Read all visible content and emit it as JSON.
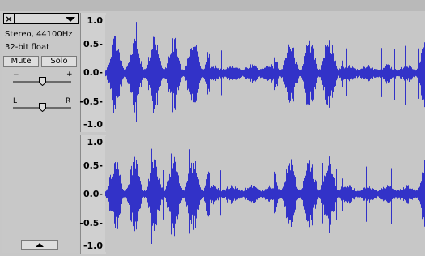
{
  "track": {
    "close_glyph": "×",
    "name": "",
    "dropdown_icon": "chevron-down-icon",
    "sample_info": "Stereo, 44100Hz",
    "format_info": "32-bit float",
    "mute_label": "Mute",
    "solo_label": "Solo",
    "gain": {
      "min_label": "−",
      "max_label": "+",
      "level": 0.5
    },
    "pan": {
      "left_label": "L",
      "right_label": "R",
      "level": 0.5
    },
    "collapse_icon": "triangle-up-icon"
  },
  "channels": [
    {
      "name": "left",
      "ticks": [
        "1.0",
        "0.5-",
        "0.0-",
        "-0.5-",
        "-1.0"
      ]
    },
    {
      "name": "right",
      "ticks": [
        "1.0",
        "0.5-",
        "0.0-",
        "-0.5-",
        "-1.0"
      ]
    }
  ],
  "colors": {
    "waveform": "#3232c8",
    "wave_bg": "#ffffff",
    "clip_bg": "#c7c7c7"
  }
}
